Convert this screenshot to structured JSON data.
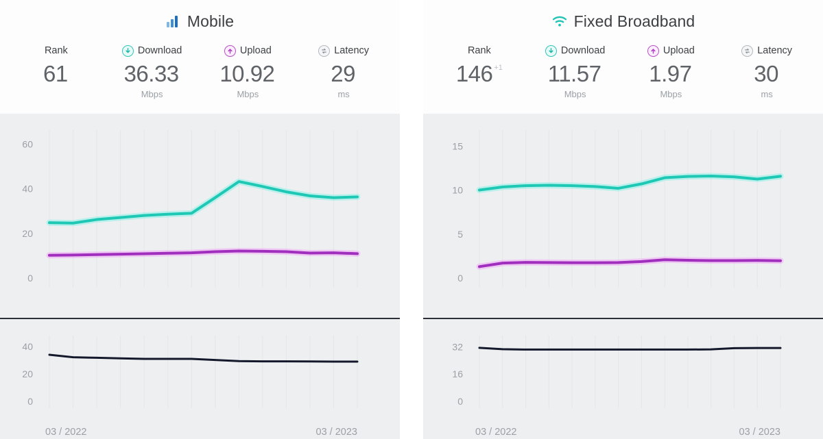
{
  "panels": [
    {
      "id": "mobile",
      "title": "Mobile",
      "title_icon": "signal-bars-icon",
      "metrics": [
        {
          "label": "Rank",
          "icon": "none",
          "value": "61",
          "sup": "",
          "unit": ""
        },
        {
          "label": "Download",
          "icon": "download-icon",
          "value": "36.33",
          "sup": "",
          "unit": "Mbps"
        },
        {
          "label": "Upload",
          "icon": "upload-icon",
          "value": "10.92",
          "sup": "",
          "unit": "Mbps"
        },
        {
          "label": "Latency",
          "icon": "latency-icon",
          "value": "29",
          "sup": "",
          "unit": "ms"
        }
      ]
    },
    {
      "id": "fixed",
      "title": "Fixed Broadband",
      "title_icon": "wifi-icon",
      "metrics": [
        {
          "label": "Rank",
          "icon": "none",
          "value": "146",
          "sup": "+1",
          "unit": ""
        },
        {
          "label": "Download",
          "icon": "download-icon",
          "value": "11.57",
          "sup": "",
          "unit": "Mbps"
        },
        {
          "label": "Upload",
          "icon": "upload-icon",
          "value": "1.97",
          "sup": "",
          "unit": "Mbps"
        },
        {
          "label": "Latency",
          "icon": "latency-icon",
          "value": "30",
          "sup": "",
          "unit": "ms"
        }
      ]
    }
  ],
  "colors": {
    "download": "#1ec8b4",
    "download_glow": "#8ef0e6",
    "upload": "#a02fbd",
    "upload_glow": "#f0a8f5",
    "latency": "#14182b",
    "panel_bg": "#eeeff1",
    "header_bg": "#fdfdfd"
  },
  "chart_data": [
    {
      "type": "line",
      "title": "Mobile",
      "panel": "mobile",
      "section": "speed",
      "xlabel": "",
      "ylabel": "Mbps",
      "ylim": [
        0,
        65
      ],
      "yticks": [
        0,
        20,
        40,
        60
      ],
      "ytick_labels": [
        "0",
        "20",
        "40",
        "60"
      ],
      "xticks": [
        "03 / 2022",
        "03 / 2023"
      ],
      "x": [
        "03/2022",
        "04/2022",
        "05/2022",
        "06/2022",
        "07/2022",
        "08/2022",
        "09/2022",
        "10/2022",
        "11/2022",
        "12/2022",
        "01/2023",
        "02/2023",
        "03/2023"
      ],
      "grid": true,
      "legend": "none",
      "series": [
        {
          "name": "Download",
          "color": "#1ec8b4",
          "values": [
            24.8,
            24.6,
            26.2,
            27.1,
            28.0,
            28.6,
            29.0,
            36.0,
            43.2,
            41.0,
            38.6,
            36.8,
            36.0,
            36.33
          ]
        },
        {
          "name": "Upload",
          "color": "#a02fbd",
          "values": [
            10.2,
            10.3,
            10.5,
            10.7,
            10.9,
            11.1,
            11.3,
            11.8,
            12.1,
            12.0,
            11.8,
            11.2,
            11.3,
            10.92
          ]
        }
      ]
    },
    {
      "type": "line",
      "title": "Mobile Latency",
      "panel": "mobile",
      "section": "latency",
      "xlabel": "",
      "ylabel": "ms",
      "ylim": [
        0,
        46
      ],
      "yticks": [
        0,
        20,
        40
      ],
      "ytick_labels": [
        "0",
        "20",
        "40"
      ],
      "xticks": [
        "03 / 2022",
        "03 / 2023"
      ],
      "grid": true,
      "legend": "none",
      "series": [
        {
          "name": "Latency",
          "color": "#14182b",
          "values": [
            34.0,
            32.2,
            31.8,
            31.4,
            31.0,
            31.0,
            31.0,
            30.2,
            29.4,
            29.2,
            29.2,
            29.1,
            29.0,
            29.0
          ]
        }
      ]
    },
    {
      "type": "line",
      "title": "Fixed Broadband",
      "panel": "fixed",
      "section": "speed",
      "xlabel": "",
      "ylabel": "Mbps",
      "ylim": [
        0,
        16.5
      ],
      "yticks": [
        0,
        5,
        10,
        15
      ],
      "ytick_labels": [
        "0",
        "5",
        "10",
        "15"
      ],
      "xticks": [
        "03 / 2022",
        "03 / 2023"
      ],
      "grid": true,
      "legend": "none",
      "series": [
        {
          "name": "Download",
          "color": "#1ec8b4",
          "values": [
            10.0,
            10.35,
            10.5,
            10.55,
            10.5,
            10.4,
            10.2,
            10.7,
            11.4,
            11.55,
            11.6,
            11.5,
            11.25,
            11.57
          ]
        },
        {
          "name": "Upload",
          "color": "#a02fbd",
          "values": [
            1.3,
            1.7,
            1.78,
            1.76,
            1.74,
            1.74,
            1.76,
            1.88,
            2.08,
            2.02,
            1.98,
            1.98,
            2.0,
            1.97
          ]
        }
      ]
    },
    {
      "type": "line",
      "title": "Fixed Broadband Latency",
      "panel": "fixed",
      "section": "latency",
      "xlabel": "",
      "ylabel": "ms",
      "ylim": [
        0,
        37
      ],
      "yticks": [
        0,
        16,
        32
      ],
      "ytick_labels": [
        "0",
        "16",
        "32"
      ],
      "xticks": [
        "03 / 2022",
        "03 / 2023"
      ],
      "grid": true,
      "legend": "none",
      "series": [
        {
          "name": "Latency",
          "color": "#14182b",
          "values": [
            31.4,
            30.6,
            30.4,
            30.4,
            30.4,
            30.4,
            30.4,
            30.4,
            30.4,
            30.4,
            30.5,
            31.2,
            31.3,
            31.3
          ]
        }
      ]
    }
  ]
}
